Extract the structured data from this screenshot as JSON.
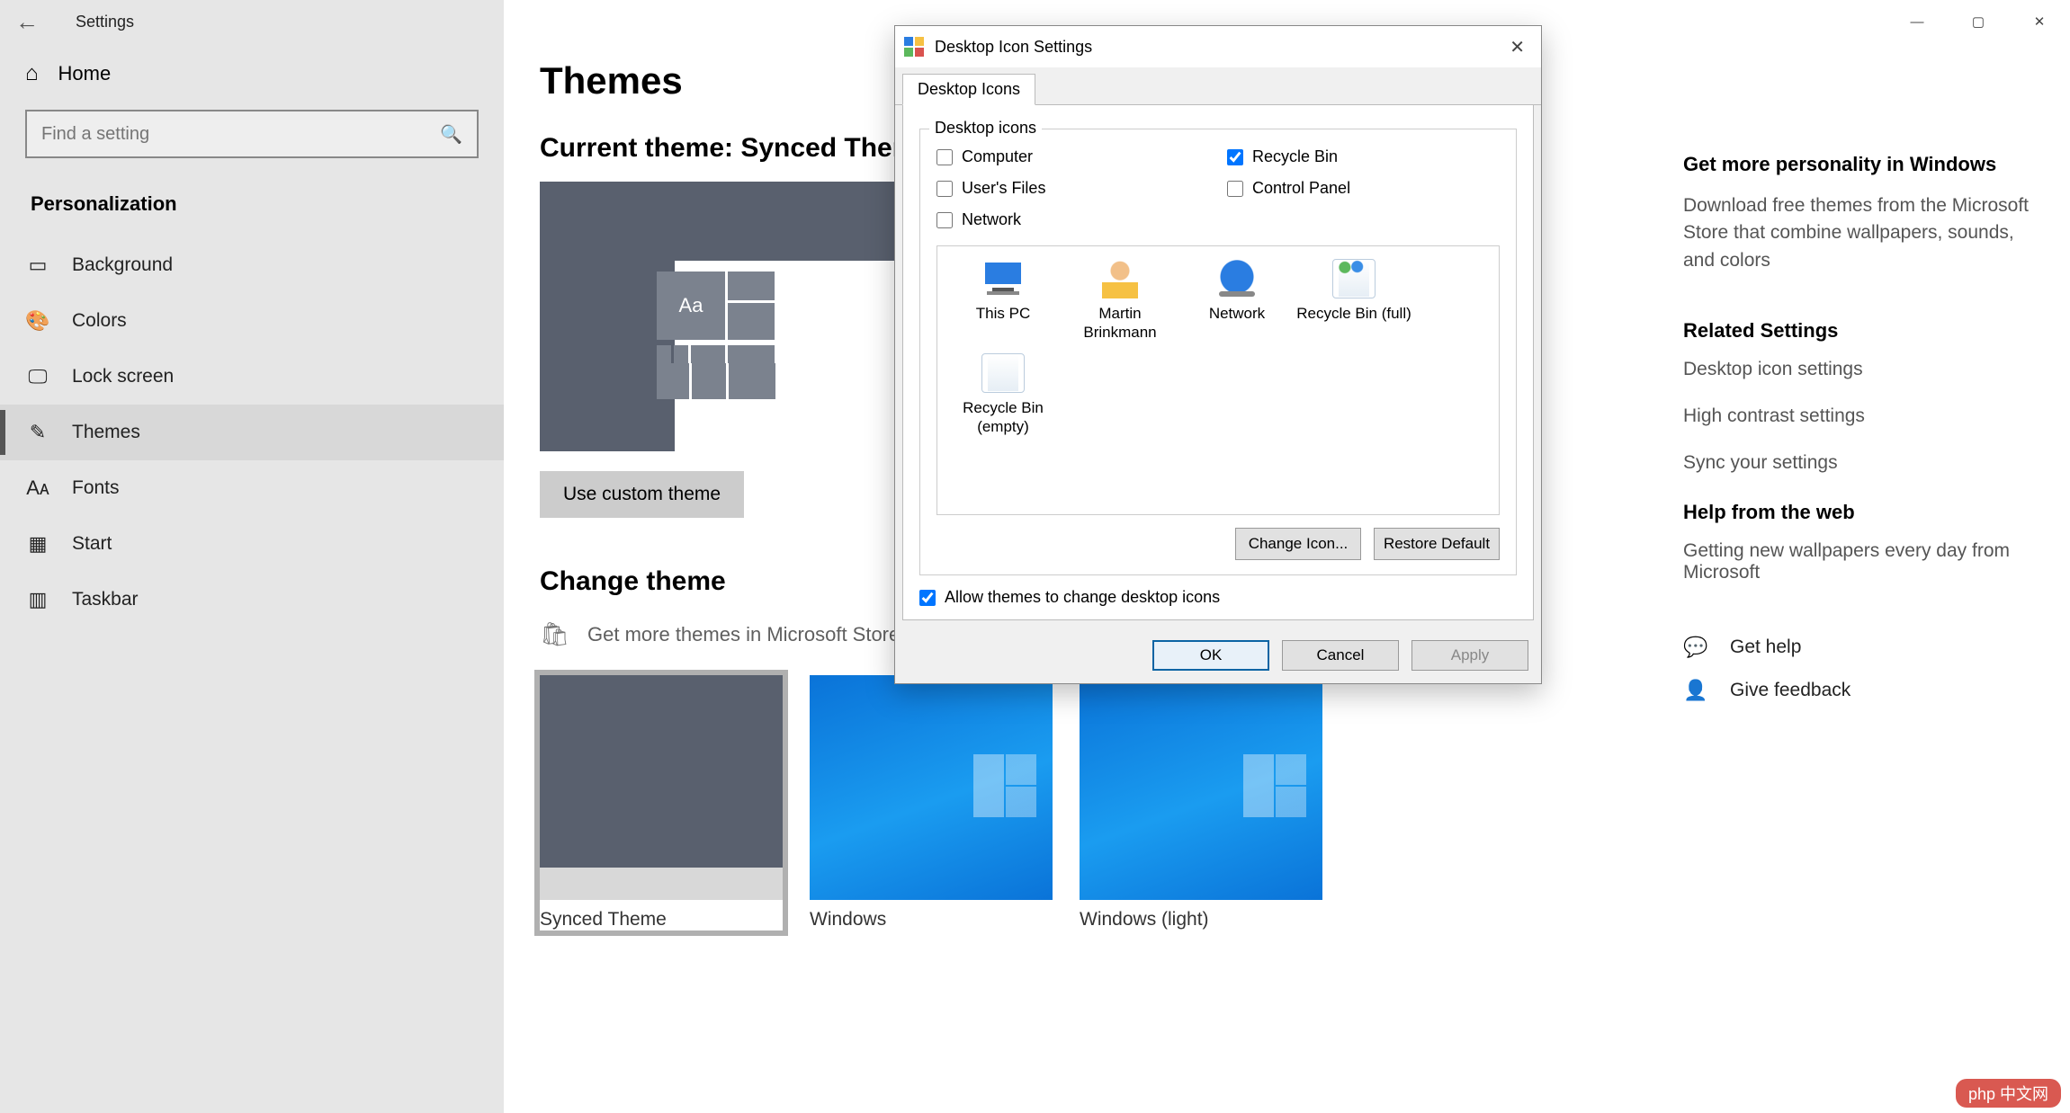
{
  "window": {
    "app_title": "Settings",
    "controls": {
      "min": "—",
      "max": "▢",
      "close": "✕"
    }
  },
  "sidebar": {
    "home": "Home",
    "search_placeholder": "Find a setting",
    "section": "Personalization",
    "items": [
      {
        "icon": "▭",
        "label": "Background"
      },
      {
        "icon": "🎨",
        "label": "Colors"
      },
      {
        "icon": "🖵",
        "label": "Lock screen"
      },
      {
        "icon": "✎",
        "label": "Themes"
      },
      {
        "icon": "Aᴀ",
        "label": "Fonts"
      },
      {
        "icon": "▦",
        "label": "Start"
      },
      {
        "icon": "▥",
        "label": "Taskbar"
      }
    ],
    "selected_index": 3
  },
  "main": {
    "heading": "Themes",
    "current_theme_label": "Current theme: Synced Theme",
    "preview_sample": "Aa",
    "use_custom_btn": "Use custom theme",
    "change_heading": "Change theme",
    "store_link": "Get more themes in Microsoft Store",
    "themes": [
      {
        "name": "Synced Theme",
        "style": "gray",
        "selected": true
      },
      {
        "name": "Windows",
        "style": "blue",
        "selected": false
      },
      {
        "name": "Windows (light)",
        "style": "blue",
        "selected": false
      }
    ]
  },
  "right": {
    "promo_title": "Get more personality in Windows",
    "promo_body": "Download free themes from the Microsoft Store that combine wallpapers, sounds, and colors",
    "related_title": "Related Settings",
    "related_links": [
      "Desktop icon settings",
      "High contrast settings",
      "Sync your settings"
    ],
    "help_title": "Help from the web",
    "help_links": [
      "Getting new wallpapers every day from Microsoft"
    ],
    "actions": [
      {
        "icon": "💬",
        "label": "Get help"
      },
      {
        "icon": "👤",
        "label": "Give feedback"
      }
    ]
  },
  "dialog": {
    "title": "Desktop Icon Settings",
    "tab": "Desktop Icons",
    "group_title": "Desktop icons",
    "checks": {
      "computer": {
        "label": "Computer",
        "checked": false
      },
      "recycle_bin": {
        "label": "Recycle Bin",
        "checked": true
      },
      "users_files": {
        "label": "User's Files",
        "checked": false
      },
      "control_panel": {
        "label": "Control Panel",
        "checked": false
      },
      "network": {
        "label": "Network",
        "checked": false
      }
    },
    "icons": [
      {
        "name": "This PC",
        "kind": "pc"
      },
      {
        "name": "Martin Brinkmann",
        "kind": "user"
      },
      {
        "name": "Network",
        "kind": "net"
      },
      {
        "name": "Recycle Bin (full)",
        "kind": "rbfull"
      },
      {
        "name": "Recycle Bin (empty)",
        "kind": "rbempty"
      }
    ],
    "change_icon_btn": "Change Icon...",
    "restore_btn": "Restore Default",
    "allow_label": "Allow themes to change desktop icons",
    "allow_checked": true,
    "ok": "OK",
    "cancel": "Cancel",
    "apply": "Apply"
  },
  "watermark": "php 中文网"
}
